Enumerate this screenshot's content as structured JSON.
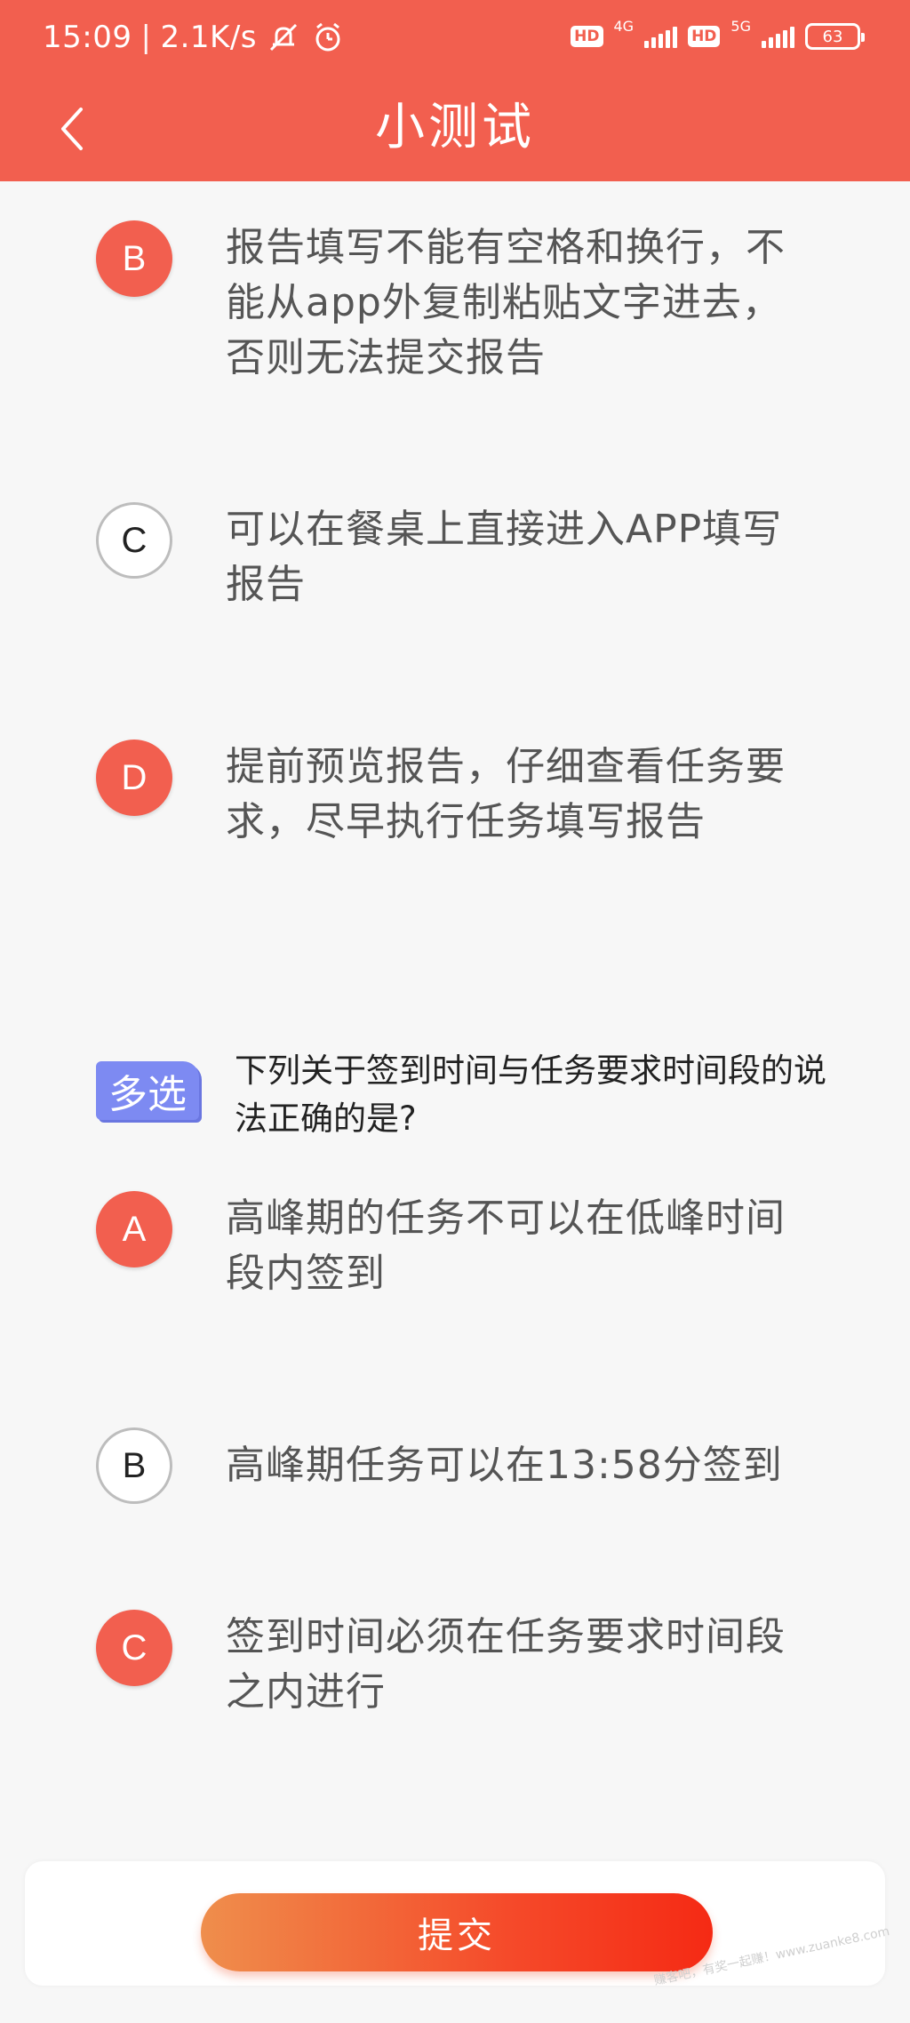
{
  "status_bar": {
    "time": "15:09",
    "separator": "|",
    "speed": "2.1K/s",
    "hd1": "HD",
    "net1": "4G",
    "hd2": "HD",
    "net2": "5G",
    "battery": "63"
  },
  "header": {
    "title": "小测试",
    "bg_color": "#f25f4f"
  },
  "options_prev": [
    {
      "letter": "B",
      "text": "报告填写不能有空格和换行，不能从app外复制粘贴文字进去，否则无法提交报告",
      "selected": true
    },
    {
      "letter": "C",
      "text": "可以在餐桌上直接进入APP填写报告",
      "selected": false
    },
    {
      "letter": "D",
      "text": "提前预览报告，仔细查看任务要求，尽早执行任务填写报告",
      "selected": true
    }
  ],
  "question": {
    "tag": "多选",
    "text": "下列关于签到时间与任务要求时间段的说法正确的是?"
  },
  "options": [
    {
      "letter": "A",
      "text": "高峰期的任务不可以在低峰时间段内签到",
      "selected": true
    },
    {
      "letter": "B",
      "text": "高峰期任务可以在13:58分签到",
      "selected": false
    },
    {
      "letter": "C",
      "text": "签到时间必须在任务要求时间段之内进行",
      "selected": true
    }
  ],
  "submit": {
    "label": "提交"
  },
  "watermark": "赚客吧，有奖一起赚！www.zuanke8.com"
}
